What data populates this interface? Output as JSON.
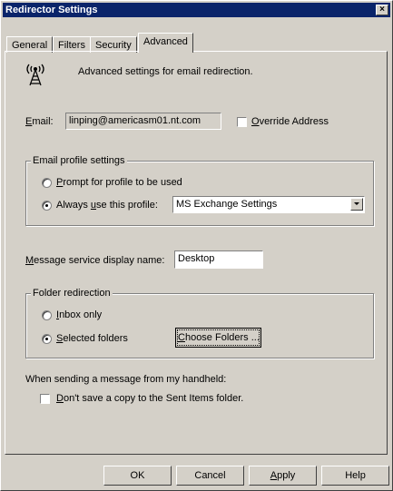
{
  "window": {
    "title": "Redirector Settings",
    "close_glyph": "×"
  },
  "tabs": [
    {
      "label": "General",
      "active": false
    },
    {
      "label": "Filters",
      "active": false
    },
    {
      "label": "Security",
      "active": false
    },
    {
      "label": "Advanced",
      "active": true
    }
  ],
  "header": {
    "icon": "antenna-icon",
    "description": "Advanced settings for email redirection."
  },
  "email": {
    "label_mnemonic": "E",
    "label_rest": "mail:",
    "value": "linping@americasm01.nt.com",
    "override_mnemonic": "O",
    "override_rest": "verride Address",
    "override_checked": false
  },
  "email_profile": {
    "legend": "Email profile settings",
    "prompt_mnemonic": "P",
    "prompt_rest": "rompt for profile to be used",
    "prompt_selected": false,
    "always_pre": "Always ",
    "always_mnemonic": "u",
    "always_post": "se this profile:",
    "always_selected": true,
    "profile_value": "MS Exchange Settings"
  },
  "message_service": {
    "label_mnemonic": "M",
    "label_rest": "essage service display name:",
    "value": "Desktop"
  },
  "folder_redirection": {
    "legend": "Folder redirection",
    "inbox_mnemonic": "I",
    "inbox_rest": "nbox only",
    "inbox_selected": false,
    "selected_mnemonic": "S",
    "selected_rest": "elected folders",
    "selected_selected": true,
    "choose_mnemonic": "C",
    "choose_rest": "hoose Folders ..."
  },
  "handheld": {
    "heading": "When sending a message from my handheld:",
    "dont_save_mnemonic": "D",
    "dont_save_rest": "on't save a copy to the Sent Items folder.",
    "dont_save_checked": false
  },
  "buttons": {
    "ok": "OK",
    "cancel": "Cancel",
    "apply_mnemonic": "A",
    "apply_rest": "pply",
    "help": "Help"
  },
  "colors": {
    "titlebar": "#0a246a",
    "face": "#d4d0c8"
  }
}
